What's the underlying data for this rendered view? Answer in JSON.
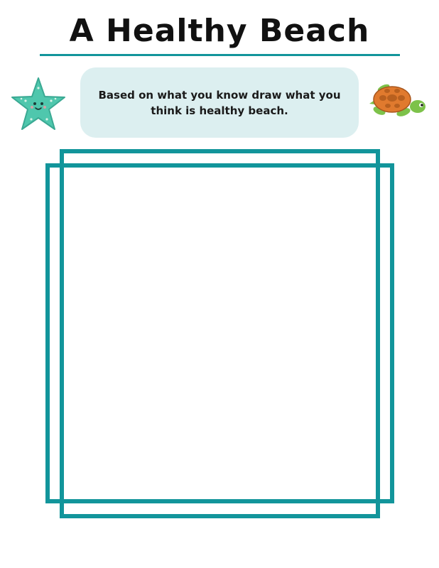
{
  "worksheet": {
    "title": "A Healthy Beach",
    "instruction": "Based on what you know draw what you think is healthy beach."
  },
  "decorations": {
    "left_icon": "starfish-icon",
    "right_icon": "sea-turtle-icon"
  },
  "colors": {
    "accent": "#12959b",
    "instruction_bg": "#dceff0",
    "starfish": "#4fc7ad",
    "turtle_shell": "#e07a2e",
    "turtle_skin": "#7dc24a"
  }
}
